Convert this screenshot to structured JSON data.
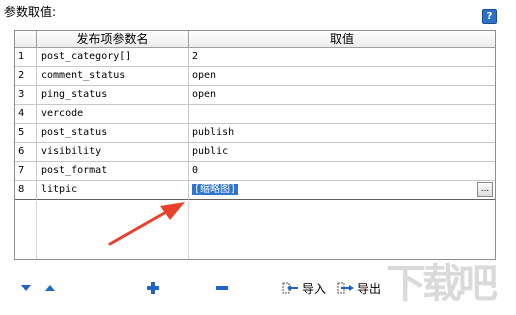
{
  "panel": {
    "title": "参数取值:",
    "help_icon": "?"
  },
  "grid": {
    "columns": [
      "发布项参数名",
      "取值"
    ],
    "rows": [
      {
        "num": "1",
        "name": "post_category[]",
        "value": "2"
      },
      {
        "num": "2",
        "name": "comment_status",
        "value": "open"
      },
      {
        "num": "3",
        "name": "ping_status",
        "value": "open"
      },
      {
        "num": "4",
        "name": "vercode",
        "value": ""
      },
      {
        "num": "5",
        "name": "post_status",
        "value": "publish"
      },
      {
        "num": "6",
        "name": "visibility",
        "value": "public"
      },
      {
        "num": "7",
        "name": "post_format",
        "value": "0"
      },
      {
        "num": "8",
        "name": "litpic",
        "value": "[缩略图]"
      }
    ],
    "ellipsis_label": "..."
  },
  "toolbar": {
    "import_label": "导入",
    "export_label": "导出",
    "down_icon": "arrow-down-icon",
    "up_icon": "arrow-up-icon",
    "add_icon": "plus-icon",
    "remove_icon": "minus-icon"
  },
  "colors": {
    "accent": "#2f74d0",
    "annotation_arrow": "#e8412c",
    "icon_blue": "#1f64c8"
  },
  "watermark": "下载吧"
}
